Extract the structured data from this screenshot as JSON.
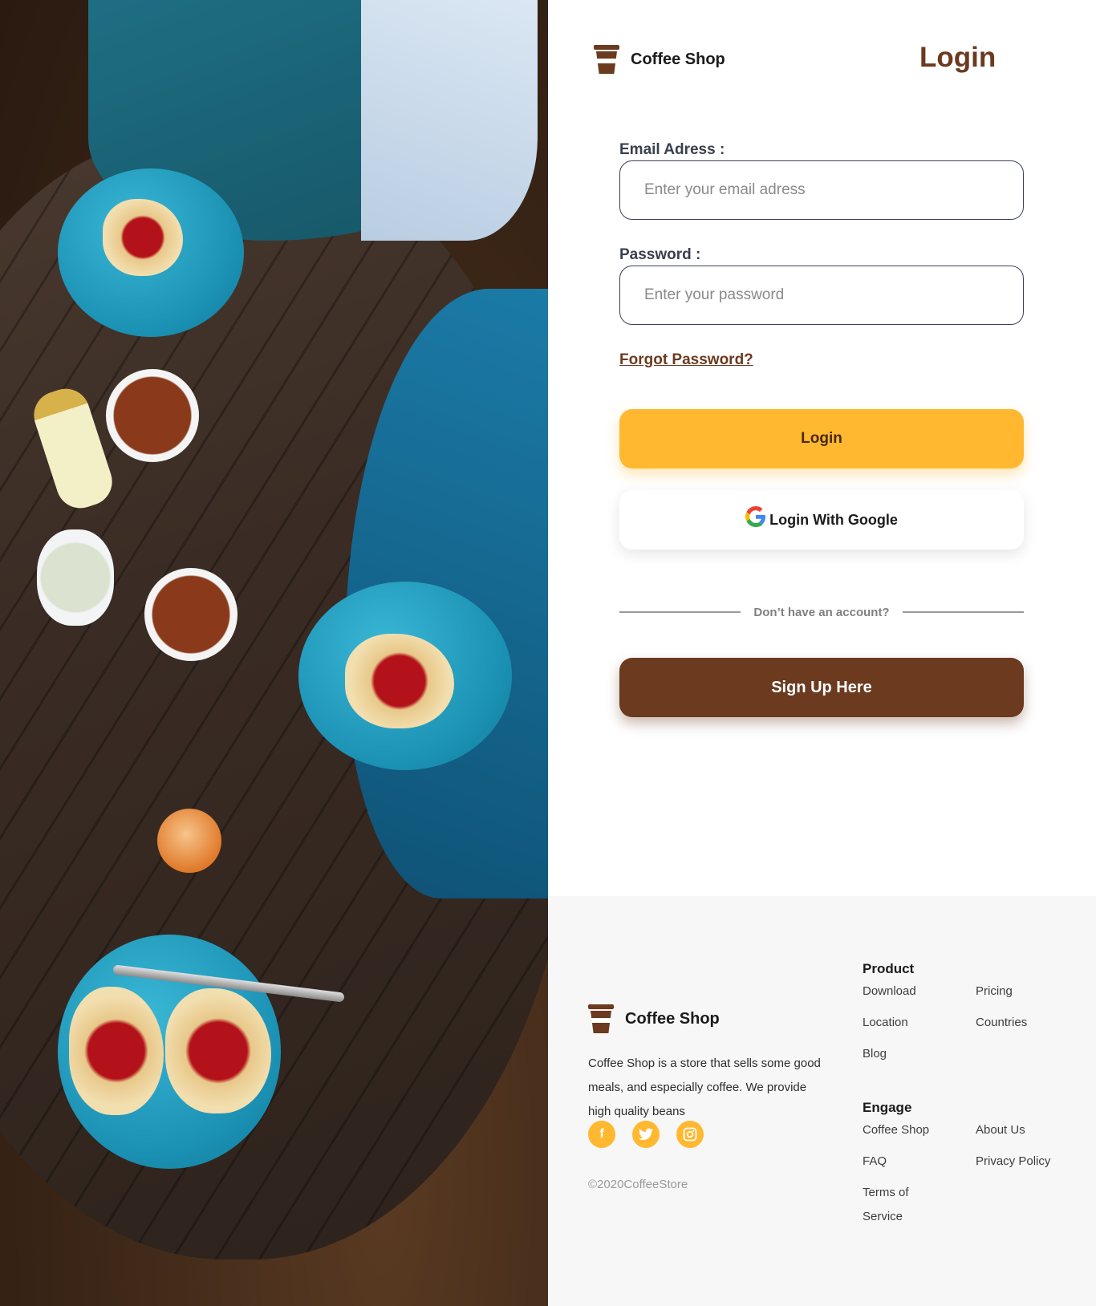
{
  "brand": {
    "name": "Coffee Shop"
  },
  "login": {
    "title": "Login",
    "email_label": "Email Adress :",
    "email_placeholder": "Enter your email adress",
    "password_label": "Password :",
    "password_placeholder": "Enter your password",
    "forgot_label": "Forgot Password?",
    "login_button": "Login",
    "google_button": "Login With Google",
    "no_account_text": "Don’t have an account?",
    "signup_button": "Sign Up Here"
  },
  "footer": {
    "brand_name": "Coffee Shop",
    "about": "Coffee Shop is a store that sells some good meals, and especially coffee. We provide high quality beans",
    "socials": [
      {
        "icon": "facebook-icon",
        "glyph": "f"
      },
      {
        "icon": "twitter-icon",
        "glyph": "t"
      },
      {
        "icon": "instagram-icon",
        "glyph": "◎"
      }
    ],
    "copyright": "©2020CoffeeStore",
    "product": {
      "heading": "Product",
      "links": [
        "Download",
        "Pricing",
        "Location",
        "Countries",
        "Blog"
      ]
    },
    "engage": {
      "heading": "Engage",
      "links": [
        "Coffee Shop",
        "About Us",
        "FAQ",
        "Privacy Policy",
        "Terms of Service"
      ]
    }
  },
  "colors": {
    "accent_yellow": "#ffb830",
    "brand_brown": "#6b3a1f",
    "footer_bg": "#f7f7f7"
  }
}
